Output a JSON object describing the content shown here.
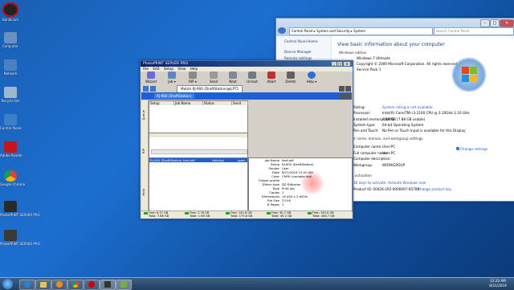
{
  "desktop": {
    "icons": [
      {
        "label": "Bandicam",
        "color": "#222222"
      },
      {
        "label": "Computer",
        "color": "#6a8fc1"
      },
      {
        "label": "Network",
        "color": "#4a7fc0"
      },
      {
        "label": "Recycle Bin",
        "color": "#9bb7d0"
      },
      {
        "label": "Control Panel",
        "color": "#3d7ec8"
      },
      {
        "label": "Adobe Reader",
        "color": "#c4161c"
      },
      {
        "label": "Google Chrome",
        "color": "#e8b400"
      },
      {
        "label": "PhotoPRINT SERVER PRO",
        "color": "#2a2a2a"
      },
      {
        "label": "PhotoPRINT SERVER PRO",
        "color": "#3a3a3a"
      }
    ]
  },
  "system_window": {
    "address": [
      "Control Panel",
      "System and Security",
      "System"
    ],
    "search_placeholder": "Search Control Panel",
    "left_links": [
      "Control Panel Home",
      "Device Manager",
      "Remote settings",
      "System protection",
      "Advanced system settings"
    ],
    "heading": "View basic information about your computer",
    "edition_header": "Windows edition",
    "edition": "Windows 7 Ultimate",
    "copyright": "Copyright © 2009 Microsoft Corporation.  All rights reserved.",
    "service_pack": "Service Pack 1",
    "rating_label": "Rating:",
    "rating_value": "System rating is not available",
    "rows": [
      {
        "label": "Processor:",
        "value": "Intel(R) Core(TM) i3-2100 CPU @ 3.10GHz   3.10 GHz"
      },
      {
        "label": "Installed memory (RAM):",
        "value": "8.00 GB (7.88 GB usable)"
      },
      {
        "label": "System type:",
        "value": "64-bit Operating System"
      },
      {
        "label": "Pen and Touch:",
        "value": "No Pen or Touch Input is available for this Display"
      }
    ],
    "domain_header": "Computer name, domain, and workgroup settings",
    "name_rows": [
      {
        "label": "Computer name:",
        "value": "User-PC"
      },
      {
        "label": "Full computer name:",
        "value": "User-PC"
      },
      {
        "label": "Computer description:",
        "value": ""
      },
      {
        "label": "Workgroup:",
        "value": "WORKGROUP"
      }
    ],
    "change_settings": "Change settings",
    "activation_header": "Windows activation",
    "activation_link": "30 days to activate. Activate Windows now",
    "product_id": "Product ID: 00426-292-0000007-85789",
    "change_key": "Change product key"
  },
  "photoprint": {
    "title": "PhotoPRINT SERVER PRO",
    "menu": [
      "File",
      "Edit",
      "Setup",
      "View",
      "Help"
    ],
    "toolbar": [
      {
        "label": "Wizard",
        "icon": "wizard-icon"
      },
      {
        "label": "Job",
        "icon": "job-icon"
      },
      {
        "label": "RIP",
        "icon": "rip-icon"
      },
      {
        "label": "Send",
        "icon": "send-icon"
      },
      {
        "label": "Next",
        "icon": "next-icon"
      },
      {
        "label": "Unrout",
        "icon": "unrout-icon"
      },
      {
        "label": "Abort",
        "icon": "abort-icon"
      },
      {
        "label": "Delete",
        "icon": "delete-icon"
      },
      {
        "label": "Help",
        "icon": "help-icon"
      }
    ],
    "printer_tab": "Mutoh RJ-900 (DraftStation)@LPT1",
    "queue_tab": "RJ-900 (DraftStation)",
    "queue_columns": [
      "Setup",
      "Job Name",
      "Status",
      "Send"
    ],
    "ready_row": {
      "setup": "RJ-900 (DraftStation)",
      "job": "test.pdf",
      "status": "Holding",
      "send": "open"
    },
    "side_labels": [
      "Queue",
      "RIP",
      "Hold"
    ],
    "details": [
      {
        "label": "Job Name",
        "value": "test.pdf"
      },
      {
        "label": "Setup",
        "value": "RJ-900 (DraftStation)"
      },
      {
        "label": "Sender",
        "value": "User"
      },
      {
        "label": "Date",
        "value": "8/21/2019 12:20 AM"
      },
      {
        "label": "Color",
        "value": "CMYK (variable dot)"
      },
      {
        "label": "Output profile",
        "value": ""
      },
      {
        "label": "Dither type",
        "value": "SD Diffusion"
      },
      {
        "label": "Type",
        "value": "Print job"
      },
      {
        "label": "Copies",
        "value": "1"
      },
      {
        "label": "Dimensions",
        "value": "14.400 x 2.642in"
      },
      {
        "label": "File Size",
        "value": "23.5K"
      },
      {
        "label": "# Pages",
        "value": "1"
      }
    ],
    "status": [
      {
        "line1": "Free: 6.37 GB",
        "line2": "Total: 7.88 GB",
        "color": "#2aa02a"
      },
      {
        "line1": "Free: 1.78 GB",
        "line2": "Total: 1.96 GB",
        "color": "#2aa02a"
      },
      {
        "line1": "Free: 141.6 GB",
        "line2": "Total: 175.8 GB",
        "color": "#2aa02a"
      },
      {
        "line1": "Free: 30.7 GB",
        "line2": "Total: 49.2 GB",
        "color": "#2aa02a"
      },
      {
        "line1": "Free: 144.0 GB",
        "line2": "Total: 446.7 GB",
        "color": "#2aa02a"
      }
    ]
  },
  "taskbar": {
    "apps": [
      "start-orb",
      "ie-icon",
      "explorer-icon",
      "media-icon",
      "chrome-icon",
      "bandicam-icon",
      "photoprint-icon",
      "control-panel-icon"
    ],
    "time": "12:20 AM",
    "date": "8/21/2019"
  }
}
